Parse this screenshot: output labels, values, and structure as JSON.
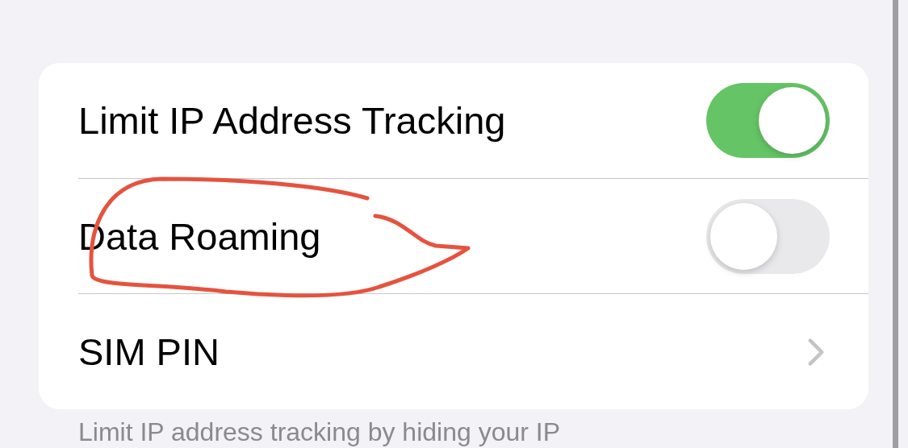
{
  "settings_group": [
    {
      "kind": "toggle",
      "label": "Limit IP Address Tracking",
      "on": true
    },
    {
      "kind": "toggle",
      "label": "Data Roaming",
      "on": false
    },
    {
      "kind": "link",
      "label": "SIM PIN"
    }
  ],
  "footer": "Limit IP address tracking by hiding your IP",
  "annotations": [
    {
      "kind": "loop",
      "color": "#e5533f"
    }
  ]
}
